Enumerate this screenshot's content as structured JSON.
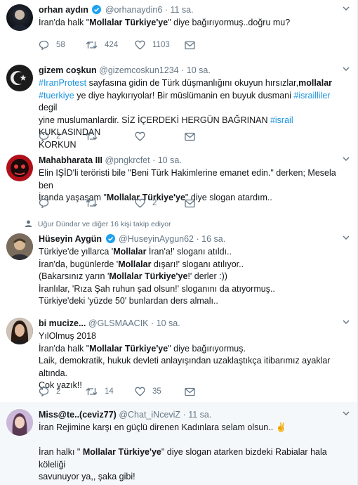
{
  "tweets": [
    {
      "name": "orhan aydın",
      "verified": true,
      "handle": "@orhanaydin6",
      "time": "11 sa.",
      "lines": [
        [
          {
            "t": "İran'da halk \""
          },
          {
            "t": "Mollalar Türkiye'ye",
            "b": true
          },
          {
            "t": "\" diye bağırıyormuş..doğru mu?"
          }
        ]
      ],
      "actions": {
        "reply": "58",
        "retweet": "424",
        "like": "1103"
      }
    },
    {
      "name": "gizem coşkun",
      "verified": false,
      "handle": "@gizemcoskun1234",
      "time": "10 sa.",
      "lines": [
        [
          {
            "t": "#IranProtest",
            "tag": true
          },
          {
            "t": " sayfasına gidin de Türk düşmanlığını okuyun  hırsızlar,"
          },
          {
            "t": "mollalar",
            "b": true
          }
        ],
        [
          {
            "t": "#tuerkiye",
            "tag": true
          },
          {
            "t": " ye diye haykırıyolar! Bir müslümanin en buyuk dusmani "
          },
          {
            "t": "#israilliler",
            "tag": true
          },
          {
            "t": " degil"
          }
        ],
        [
          {
            "t": "yine muslumanlardir. SİZ İÇERDEKİ HERGÜN BAĞRINAN "
          },
          {
            "t": "#israil",
            "tag": true
          },
          {
            "t": " KUKLASINDAN"
          }
        ],
        [
          {
            "t": "KORKUN"
          }
        ]
      ],
      "actions": {
        "reply": "2",
        "retweet": "",
        "like": ""
      }
    },
    {
      "name": "Mahabharata III",
      "verified": false,
      "handle": "@pngkrcfet",
      "time": "10 sa.",
      "lines": [
        [
          {
            "t": "Elin IŞİD'li teröristi bile \"Beni Türk Hakimlerine emanet edin.\" derken; Mesela ben"
          }
        ],
        [
          {
            "t": "İranda yaşasam \""
          },
          {
            "t": "Mollalar Türkiye'ye",
            "b": true
          },
          {
            "t": "\" diye slogan atardım.."
          }
        ]
      ],
      "actions": {
        "reply": "",
        "retweet": "",
        "like": "2"
      }
    },
    {
      "social": "Uğur Dündar ve diğer 16 kişi takip ediyor",
      "name": "Hüseyin Aygün",
      "verified": true,
      "handle": "@HuseyinAygun62",
      "time": "16 sa.",
      "lines": [
        [
          {
            "t": "Türkiye'de yıllarca '"
          },
          {
            "t": "Mollalar",
            "b": true
          },
          {
            "t": " İran'a!' sloganı atıldı.."
          }
        ],
        [
          {
            "t": "İran'da, bugünlerde '"
          },
          {
            "t": "Mollalar",
            "b": true
          },
          {
            "t": " dışarı!' sloganı atılıyor.."
          }
        ],
        [
          {
            "t": "(Bakarsınız yarın '"
          },
          {
            "t": "Mollalar Türkiye'ye",
            "b": true
          },
          {
            "t": "!' derler :))"
          }
        ],
        [
          {
            "t": "İranlılar, 'Rıza Şah ruhun şad olsun!' sloganını da atıyormuş.."
          }
        ],
        [
          {
            "t": "Türkiye'deki 'yüzde 50' bunlardan ders almalı.."
          }
        ]
      ],
      "actions": null
    },
    {
      "name": "bi mucize...",
      "verified": false,
      "handle": "@GLSMAACIK",
      "time": "10 sa.",
      "lines": [
        [
          {
            "t": "YılOlmuş 2018"
          }
        ],
        [
          {
            "t": "İran'da halk \""
          },
          {
            "t": "Mollalar Türkiye'ye",
            "b": true
          },
          {
            "t": "\" diye bağırıyormuş."
          }
        ],
        [
          {
            "t": "Laik, demokratik, hukuk devleti anlayışından uzaklaştıkça itibarımız ayaklar altında."
          }
        ],
        [
          {
            "t": "Çok yazık!!"
          }
        ]
      ],
      "actions": {
        "reply": "2",
        "retweet": "14",
        "like": "35"
      }
    },
    {
      "name": "Miss@te..(ceviz77)",
      "verified": false,
      "handle": "@Chat_iNceviZ",
      "time": "11 sa.",
      "lines": [
        [
          {
            "t": "İran Rejimine karşı en güçlü direnen Kadınlara selam olsun.. ✌"
          }
        ],
        [
          {
            "t": ""
          }
        ],
        [
          {
            "t": "İran halkı \" "
          },
          {
            "t": "Mollalar Türkiye'ye",
            "b": true
          },
          {
            "t": "\" diye slogan atarken bizdeki Rabialar hala köleliği"
          }
        ],
        [
          {
            "t": "savunuyor ya,, şaka gibi!"
          }
        ]
      ],
      "actions": null
    }
  ],
  "colors": {
    "accent": "#1da1f2",
    "link": "#1b95e0",
    "muted": "#657786",
    "border": "#e6ecf0"
  }
}
